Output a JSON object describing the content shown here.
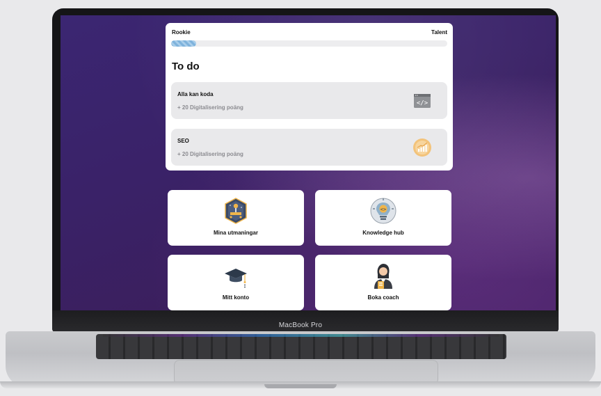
{
  "device": {
    "label": "MacBook Pro"
  },
  "progress": {
    "level_from": "Rookie",
    "level_to": "Talent",
    "fill_percent": 9
  },
  "todo": {
    "title": "To do",
    "tasks": [
      {
        "title": "Alla kan koda",
        "points": "+ 20 Digitalisering poäng",
        "icon": "code-window-icon"
      },
      {
        "title": "SEO",
        "points": "+ 20 Digitalisering poäng",
        "icon": "bar-chart-growth-icon"
      }
    ]
  },
  "tiles": [
    {
      "label": "Mina utmaningar",
      "icon": "challenge-badge-icon"
    },
    {
      "label": "Knowledge hub",
      "icon": "lightbulb-code-icon"
    },
    {
      "label": "Mitt konto",
      "icon": "graduation-cap-icon"
    },
    {
      "label": "Boka coach",
      "icon": "coach-person-icon"
    }
  ],
  "colors": {
    "background_purple": "#3b2672",
    "progress_fill": "#7fb3dc",
    "task_background": "#e9e9eb"
  }
}
